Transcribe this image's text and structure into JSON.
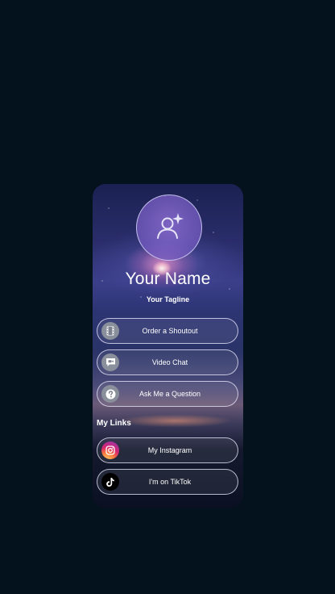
{
  "profile": {
    "name": "Your Name",
    "tagline": "Your Tagline"
  },
  "actions": [
    {
      "label": "Order a Shoutout",
      "icon": "film-icon"
    },
    {
      "label": "Video Chat",
      "icon": "video-chat-icon"
    },
    {
      "label": "Ask Me a Question",
      "icon": "question-icon"
    }
  ],
  "links_section": {
    "title": "My Links",
    "items": [
      {
        "label": "My Instagram",
        "icon": "instagram-icon"
      },
      {
        "label": "I'm on TikTok",
        "icon": "tiktok-icon"
      }
    ]
  },
  "colors": {
    "page_background": "#04121d",
    "button_border": "#ebebff"
  }
}
